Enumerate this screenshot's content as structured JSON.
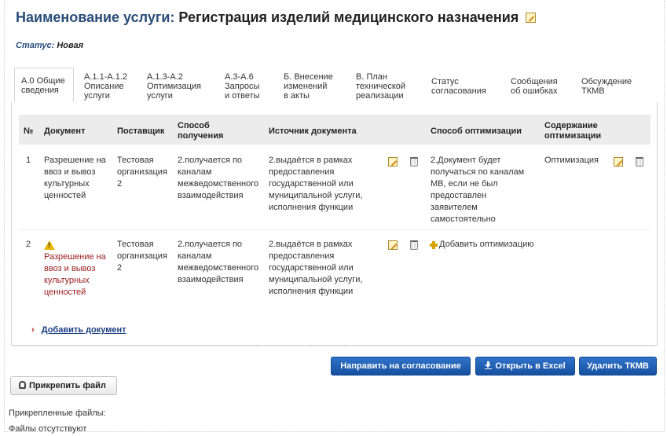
{
  "header": {
    "title_label": "Наименование услуги:",
    "title_value": "Регистрация изделий медицинского назначения",
    "status_label": "Статус:",
    "status_value": "Новая"
  },
  "tabs": [
    {
      "line1": "А.0 Общие",
      "line2": "сведения",
      "line3": "",
      "active": true
    },
    {
      "line1": "А.1.1-А.1.2",
      "line2": "Описание",
      "line3": "услуги",
      "active": false
    },
    {
      "line1": "А.1.3-А.2",
      "line2": "Оптимизация",
      "line3": "услуги",
      "active": false
    },
    {
      "line1": "А.3-А.6",
      "line2": "Запросы",
      "line3": "и ответы",
      "active": false
    },
    {
      "line1": "Б. Внесение",
      "line2": "изменений",
      "line3": "в акты",
      "active": false
    },
    {
      "line1": "В. План",
      "line2": "технической",
      "line3": "реализации",
      "active": false
    },
    {
      "line1": "Статус",
      "line2": "согласования",
      "line3": "",
      "active": false
    },
    {
      "line1": "Сообщения",
      "line2": "об ошибках",
      "line3": "",
      "active": false
    },
    {
      "line1": "Обсуждение",
      "line2": "ТКМВ",
      "line3": "",
      "active": false
    }
  ],
  "table": {
    "headers": {
      "num": "№",
      "document": "Документ",
      "supplier": "Поставщик",
      "method_line1": "Способ",
      "method_line2": "получения",
      "source": "Источник документа",
      "opt_method": "Способ оптимизации",
      "opt_content_line1": "Содержание",
      "opt_content_line2": "оптимизации"
    },
    "rows": [
      {
        "num": "1",
        "doc": [
          "Разрешение на",
          "ввоз и вывоз",
          "культурных",
          "ценностей"
        ],
        "supplier": [
          "Тестовая",
          "организация",
          "2"
        ],
        "method": [
          "2.получается по",
          "каналам",
          "межведомственного",
          "взаимодействия"
        ],
        "source": [
          "2.выдаётся в рамках",
          "предоставления",
          "государственной или",
          "муниципальной услуги,",
          "исполнения функции"
        ],
        "opt_method": [
          "2.Документ будет",
          "получаться по каналам",
          "МВ, если не был",
          "предоставлен",
          "заявителем",
          "самостоятельно"
        ],
        "opt_content": "Оптимизация"
      },
      {
        "num": "2",
        "doc": [
          "Разрешение на",
          "ввоз и вывоз",
          "культурных",
          "ценностей"
        ],
        "supplier": [
          "Тестовая",
          "организация",
          "2"
        ],
        "method": [
          "2.получается по",
          "каналам",
          "межведомственного",
          "взаимодействия"
        ],
        "source": [
          "2.выдаётся в рамках",
          "предоставления",
          "государственной или",
          "муниципальной услуги,",
          "исполнения функции"
        ],
        "add_optimization": "Добавить оптимизацию"
      }
    ]
  },
  "add_document": "Добавить документ",
  "buttons": {
    "send_approval": "Направить на согласование",
    "open_excel": "Открыть в Excel",
    "delete_tkmv": "Удалить ТКМВ",
    "attach_file": "Прикрепить файл"
  },
  "files": {
    "label": "Прикрепленные файлы:",
    "empty": "Файлы отсутствуют"
  },
  "colors": {
    "title_blue": "#2a4d7a",
    "button_blue": "#1f5fb5",
    "warning_red": "#9a1c1c",
    "link_blue": "#1a3d82"
  }
}
